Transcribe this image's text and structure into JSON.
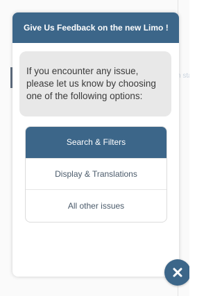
{
  "background": {
    "peek_text": "n sta"
  },
  "widget": {
    "title": "Give Us Feedback on the new Limo !",
    "message": "If you encounter any issue, please let us know by choosing one of the following options:",
    "options": [
      {
        "label": "Search & Filters",
        "selected": true
      },
      {
        "label": "Display & Translations",
        "selected": false
      },
      {
        "label": "All other issues",
        "selected": false
      }
    ]
  },
  "close_button": {
    "icon": "close-icon"
  },
  "colors": {
    "accent": "#3c6689",
    "bubble": "#e8e8e8"
  }
}
